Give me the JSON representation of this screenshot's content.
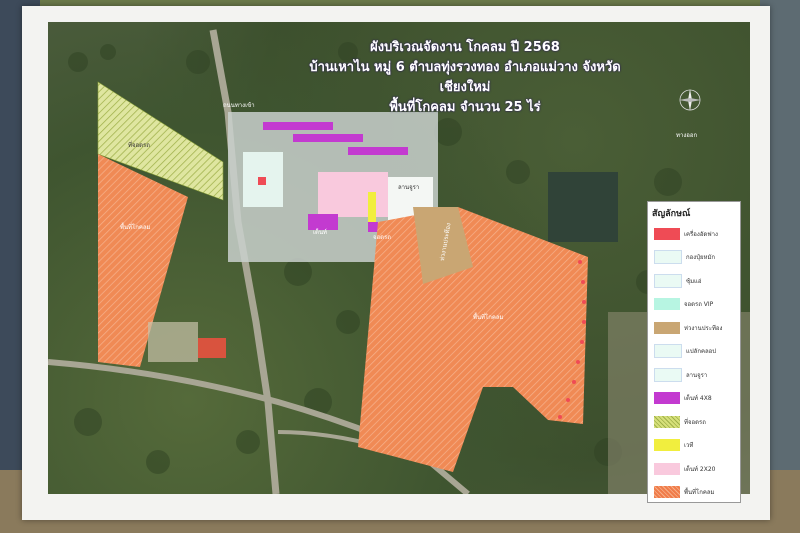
{
  "title": {
    "line1": "ผังบริเวณจัดงาน โกคลม ปี 2568",
    "line2": "บ้านเหาไน หมู่ 6 ตำบลทุ่งรวงทอง อำเภอแม่วาง จังหวัดเชียงใหม่",
    "line3": "พื้นที่โกคลม จำนวน 25 ไร่"
  },
  "legend": {
    "heading": "สัญลักษณ์",
    "items": [
      {
        "label": "เครื่องอัดฟาง",
        "color": "#ef4b55",
        "pattern": "solid"
      },
      {
        "label": "กองปุ๋ยหมัก",
        "color": "#eafaf4",
        "pattern": "solid"
      },
      {
        "label": "ซุ้มแอ่",
        "color": "#eafaf4",
        "pattern": "solid"
      },
      {
        "label": "จอดรถ VIP",
        "color": "#b7f5e2",
        "pattern": "solid"
      },
      {
        "label": "ห่วงานประทีอง",
        "color": "#c9a673",
        "pattern": "solid"
      },
      {
        "label": "แปลักคลอป",
        "color": "#eafaf4",
        "pattern": "solid"
      },
      {
        "label": "ลานจูรา",
        "color": "#eafaf4",
        "pattern": "solid"
      },
      {
        "label": "เต็นท์ 4X8",
        "color": "#c33ad0",
        "pattern": "solid"
      },
      {
        "label": "ที่จอดรถ",
        "color": "#d6e07a",
        "pattern": "hatch-green"
      },
      {
        "label": "เวที",
        "color": "#f1ee3e",
        "pattern": "solid"
      },
      {
        "label": "เต็นท์ 2X20",
        "color": "#f9c9dd",
        "pattern": "solid"
      },
      {
        "label": "พื้นที่โกคลม",
        "color": "#f07c4a",
        "pattern": "hatch-orange"
      }
    ]
  },
  "map_labels": {
    "parking": "ที่จอดรถ",
    "left_field": "พื้นที่โกคลม",
    "right_field": "พื้นที่โกคลม",
    "stage": "ห่วงานประทีอง",
    "road": "ถนนทางเข้า",
    "booth": "เต็นท์",
    "vip": "ลานจูรา",
    "side": "จอดรถ",
    "corner": "ทางออก"
  },
  "colors": {
    "field": "#f07c4a",
    "parking": "#d6e07a",
    "tent": "#c33ad0",
    "stage": "#c9a673",
    "road": "#9c9a8c"
  }
}
